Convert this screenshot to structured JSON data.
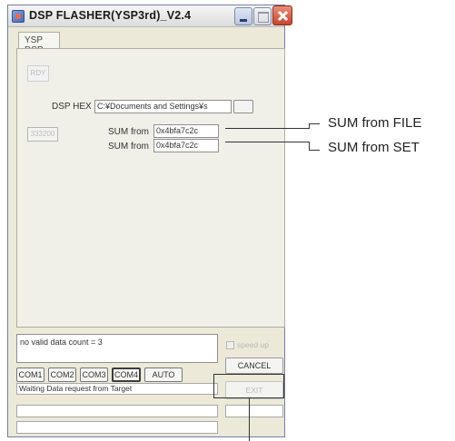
{
  "window": {
    "title": "DSP FLASHER(YSP3rd)_V2.4"
  },
  "tab": {
    "label": "YSP DSP"
  },
  "status": {
    "rdy": "RDY"
  },
  "dsp_hex": {
    "label": "DSP HEX",
    "path": "C:¥Documents and Settings¥s"
  },
  "sum": {
    "button": "333200",
    "label1": "SUM from",
    "value1": "0x4bfa7c2c",
    "label2": "SUM from",
    "value2": "0x4bfa7c2c"
  },
  "message": "no valid data count = 3",
  "speed_up": "speed up",
  "buttons": {
    "cancel": "CANCEL",
    "exit": "EXIT"
  },
  "com_ports": [
    "COM1",
    "COM2",
    "COM3",
    "COM4"
  ],
  "auto": "AUTO",
  "waiting": "Waiting Data request from Target",
  "callouts": {
    "sum_file": "SUM from FILE",
    "sum_set": "SUM from SET"
  }
}
